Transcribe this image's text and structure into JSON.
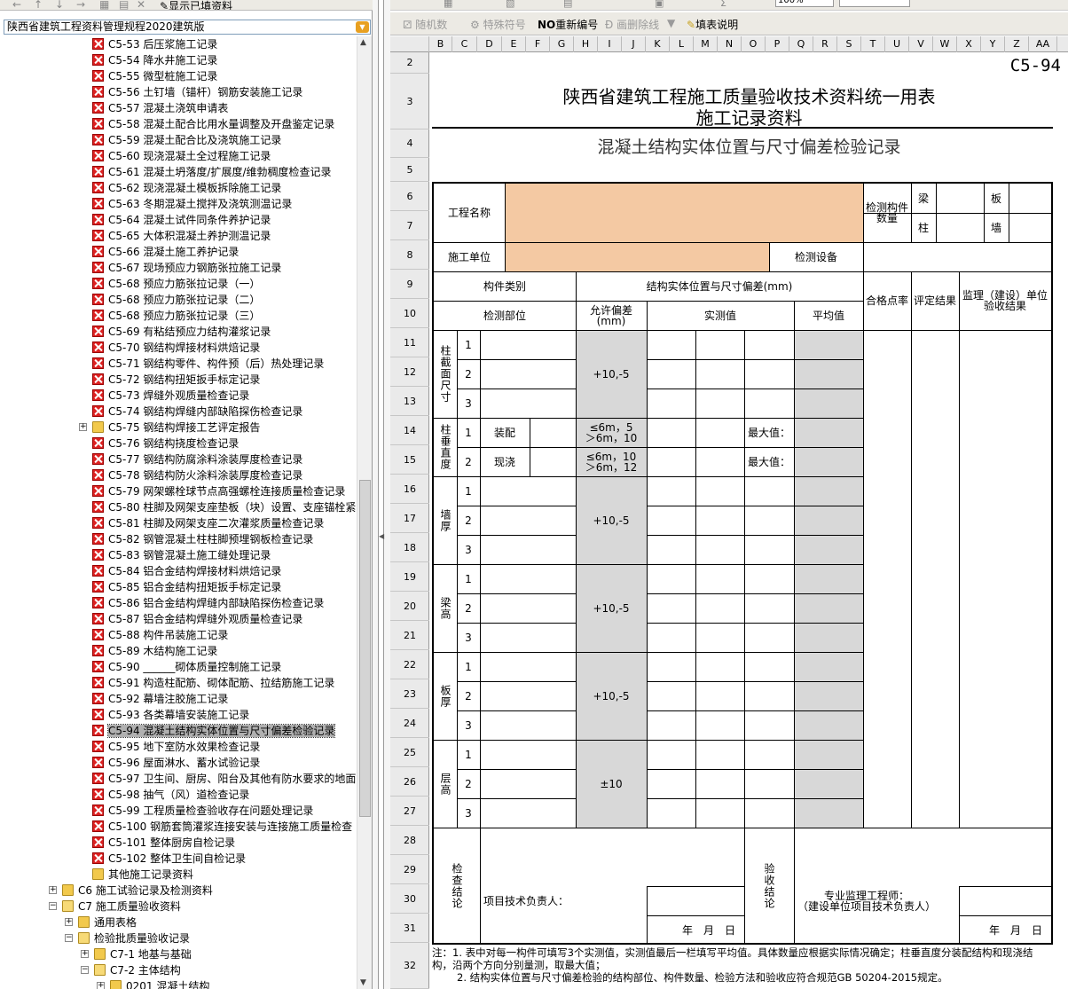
{
  "left_toolbar": {
    "show_filled_label": "显示已填资料"
  },
  "tree_combo": {
    "value": "陕西省建筑工程资料管理规程2020建筑版"
  },
  "tree": {
    "items": [
      {
        "label": "C5-53 后压浆施工记录",
        "type": "form"
      },
      {
        "label": "C5-54 降水井施工记录",
        "type": "form"
      },
      {
        "label": "C5-55 微型桩施工记录",
        "type": "form"
      },
      {
        "label": "C5-56 土钉墙（锚杆）钢筋安装施工记录",
        "type": "form"
      },
      {
        "label": "C5-57 混凝土浇筑申请表",
        "type": "form"
      },
      {
        "label": "C5-58 混凝土配合比用水量调整及开盘鉴定记录",
        "type": "form"
      },
      {
        "label": "C5-59 混凝土配合比及浇筑施工记录",
        "type": "form"
      },
      {
        "label": "C5-60 现浇混凝土全过程施工记录",
        "type": "form"
      },
      {
        "label": "C5-61 混凝土坍落度/扩展度/维勃稠度检查记录",
        "type": "form"
      },
      {
        "label": "C5-62 现浇混凝土模板拆除施工记录",
        "type": "form"
      },
      {
        "label": "C5-63 冬期混凝土搅拌及浇筑测温记录",
        "type": "form"
      },
      {
        "label": "C5-64 混凝土试件同条件养护记录",
        "type": "form"
      },
      {
        "label": "C5-65 大体积混凝土养护测温记录",
        "type": "form"
      },
      {
        "label": "C5-66 混凝土施工养护记录",
        "type": "form"
      },
      {
        "label": "C5-67 现场预应力钢筋张拉施工记录",
        "type": "form"
      },
      {
        "label": "C5-68 预应力筋张拉记录（一）",
        "type": "form"
      },
      {
        "label": "C5-68 预应力筋张拉记录（二）",
        "type": "form"
      },
      {
        "label": "C5-68 预应力筋张拉记录（三）",
        "type": "form"
      },
      {
        "label": "C5-69 有粘结预应力结构灌浆记录",
        "type": "form"
      },
      {
        "label": "C5-70 钢结构焊接材料烘焙记录",
        "type": "form"
      },
      {
        "label": "C5-71 钢结构零件、构件预（后）热处理记录",
        "type": "form"
      },
      {
        "label": "C5-72 钢结构扭矩扳手标定记录",
        "type": "form"
      },
      {
        "label": "C5-73 焊缝外观质量检查记录",
        "type": "form"
      },
      {
        "label": "C5-74 钢结构焊缝内部缺陷探伤检查记录",
        "type": "form"
      },
      {
        "label": "C5-75 钢结构焊接工艺评定报告",
        "type": "folder",
        "toggle": "+"
      },
      {
        "label": "C5-76 钢结构挠度检查记录",
        "type": "form"
      },
      {
        "label": "C5-77 钢结构防腐涂料涂装厚度检查记录",
        "type": "form"
      },
      {
        "label": "C5-78 钢结构防火涂料涂装厚度检查记录",
        "type": "form"
      },
      {
        "label": "C5-79 网架螺栓球节点高强螺栓连接质量检查记录",
        "type": "form"
      },
      {
        "label": "C5-80 柱脚及网架支座垫板（块）设置、支座锚栓紧",
        "type": "form"
      },
      {
        "label": "C5-81 柱脚及网架支座二次灌浆质量检查记录",
        "type": "form"
      },
      {
        "label": "C5-82 钢管混凝土柱柱脚预埋钢板检查记录",
        "type": "form"
      },
      {
        "label": "C5-83 钢管混凝土施工缝处理记录",
        "type": "form"
      },
      {
        "label": "C5-84 铝合金结构焊接材料烘焙记录",
        "type": "form"
      },
      {
        "label": "C5-85 铝合金结构扭矩扳手标定记录",
        "type": "form"
      },
      {
        "label": "C5-86 铝合金结构焊缝内部缺陷探伤检查记录",
        "type": "form"
      },
      {
        "label": "C5-87 铝合金结构焊缝外观质量检查记录",
        "type": "form"
      },
      {
        "label": "C5-88 构件吊装施工记录",
        "type": "form"
      },
      {
        "label": "C5-89 木结构施工记录",
        "type": "form"
      },
      {
        "label": "C5-90 ______砌体质量控制施工记录",
        "type": "form"
      },
      {
        "label": "C5-91 构造柱配筋、砌体配筋、拉结筋施工记录",
        "type": "form"
      },
      {
        "label": "C5-92 幕墙注胶施工记录",
        "type": "form"
      },
      {
        "label": "C5-93 各类幕墙安装施工记录",
        "type": "form"
      },
      {
        "label": "C5-94 混凝土结构实体位置与尺寸偏差检验记录",
        "type": "form",
        "selected": true
      },
      {
        "label": "C5-95 地下室防水效果检查记录",
        "type": "form"
      },
      {
        "label": "C5-96 屋面淋水、蓄水试验记录",
        "type": "form"
      },
      {
        "label": "C5-97 卫生间、厨房、阳台及其他有防水要求的地面",
        "type": "form"
      },
      {
        "label": "C5-98 抽气（风）道检查记录",
        "type": "form"
      },
      {
        "label": "C5-99 工程质量检查验收存在问题处理记录",
        "type": "form"
      },
      {
        "label": "C5-100 钢筋套筒灌浆连接安装与连接施工质量检查",
        "type": "form"
      },
      {
        "label": "C5-101 整体厨房自检记录",
        "type": "form"
      },
      {
        "label": "C5-102 整体卫生间自检记录",
        "type": "form"
      },
      {
        "label": "其他施工记录资料",
        "type": "folder"
      },
      {
        "label": "C6 施工试验记录及检测资料",
        "type": "folder",
        "toggle": "+",
        "indent": 1
      },
      {
        "label": "C7 施工质量验收资料",
        "type": "folderopen",
        "toggle": "-",
        "indent": 1
      },
      {
        "label": "通用表格",
        "type": "folder",
        "toggle": "+",
        "indent": 2
      },
      {
        "label": "检验批质量验收记录",
        "type": "folderopen",
        "toggle": "-",
        "indent": 2
      },
      {
        "label": "C7-1 地基与基础",
        "type": "folder",
        "toggle": "+",
        "indent": 3
      },
      {
        "label": "C7-2 主体结构",
        "type": "folderopen",
        "toggle": "-",
        "indent": 3
      },
      {
        "label": "0201 混凝土结构",
        "type": "folder",
        "toggle": "+",
        "indent": 4
      }
    ]
  },
  "right_toolbar": {
    "random_label": "随机数",
    "special_label": "特殊符号",
    "renumber_prefix": "NO",
    "renumber_label": "重新编号",
    "strike_label": "画删除线",
    "help_label": "填表说明",
    "zoom_value": "100%"
  },
  "columns": [
    "B",
    "C",
    "D",
    "E",
    "F",
    "G",
    "H",
    "I",
    "J",
    "K",
    "L",
    "M",
    "N",
    "O",
    "P",
    "Q",
    "R",
    "S",
    "T",
    "U",
    "V",
    "W",
    "X",
    "Y",
    "Z",
    "AA"
  ],
  "rows": [
    "2",
    "3",
    "4",
    "5",
    "6",
    "7",
    "8",
    "9",
    "10",
    "11",
    "12",
    "13",
    "14",
    "15",
    "16",
    "17",
    "18",
    "19",
    "20",
    "21",
    "22",
    "23",
    "24",
    "25",
    "26",
    "27",
    "28",
    "29",
    "30",
    "31",
    "32"
  ],
  "form": {
    "code": "C5-94",
    "title_line1": "陕西省建筑工程施工质量验收技术资料统一用表",
    "title_line2": "施工记录资料",
    "subtitle": "混凝土结构实体位置与尺寸偏差检验记录",
    "project_name": "工程名称",
    "inspect_count": "检测构件数量",
    "beam": "梁",
    "slab": "板",
    "column": "柱",
    "wall": "墙",
    "builder": "施工单位",
    "equipment": "检测设备",
    "member_type": "构件类别",
    "deviation_header": "结构实体位置与尺寸偏差(mm)",
    "pass_rate": "合格点率",
    "eval_result": "评定结果",
    "supervisor_result": "监理（建设）单位验收结果",
    "inspect_part": "检测部位",
    "allowed_dev": "允许偏差(mm)",
    "measured": "实测值",
    "average": "平均值",
    "g1": "柱截面尺寸",
    "g2": "柱垂直度",
    "g3": "墙厚",
    "g4": "梁高",
    "g5": "板厚",
    "g6": "层高",
    "n1": "1",
    "n2": "2",
    "n3": "3",
    "tol_std": "+10,-5",
    "tol_floor": "±10",
    "assembled": "装配",
    "cast": "现浇",
    "tol_assembled": "≤6m，5\n＞6m，10",
    "tol_cast": "≤6m，10\n＞6m，12",
    "max_value": "最大值：",
    "check_conclusion": "检查结论",
    "accept_conclusion": "验收结论",
    "project_tech_lead": "项目技术负责人：",
    "supervisor_engineer": "专业监理工程师：\n（建设单位项目技术负责人）",
    "date": "年　月　日",
    "note1": "注：1. 表中对每一构件可填写3个实测值，实测值最后一栏填写平均值。具体数量应根据实际情况确定；柱垂直度分装配结构和现浇结构，沿两个方向分别量测，取最大值；",
    "note2": "2. 结构实体位置与尺寸偏差检验的结构部位、构件数量、检验方法和验收应符合规范GB 50204-2015规定。"
  }
}
